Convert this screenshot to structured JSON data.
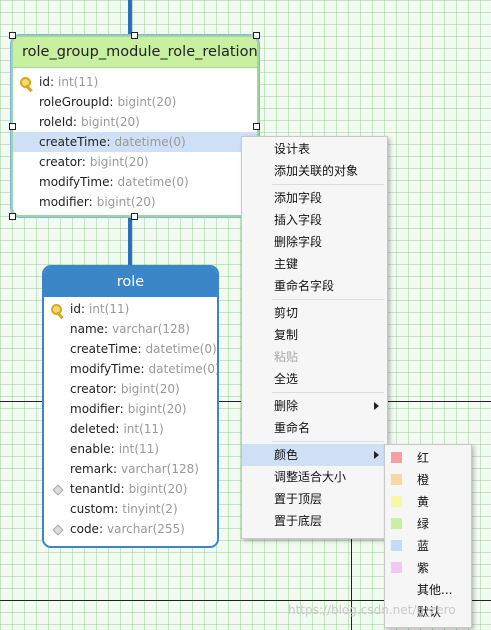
{
  "relation_entity": {
    "title": "role_group_module_role_relation",
    "fields": [
      {
        "name": "id:",
        "type": "int(11)",
        "key": true
      },
      {
        "name": "roleGroupId:",
        "type": "bigint(20)"
      },
      {
        "name": "roleId:",
        "type": "bigint(20)"
      },
      {
        "name": "createTime:",
        "type": "datetime(0)",
        "selected": true
      },
      {
        "name": "creator:",
        "type": "bigint(20)"
      },
      {
        "name": "modifyTime:",
        "type": "datetime(0)"
      },
      {
        "name": "modifier:",
        "type": "bigint(20)"
      }
    ]
  },
  "role_entity": {
    "title": "role",
    "fields": [
      {
        "name": "id:",
        "type": "int(11)",
        "icon": "key"
      },
      {
        "name": "name:",
        "type": "varchar(128)"
      },
      {
        "name": "createTime:",
        "type": "datetime(0)"
      },
      {
        "name": "modifyTime:",
        "type": "datetime(0)"
      },
      {
        "name": "creator:",
        "type": "bigint(20)"
      },
      {
        "name": "modifier:",
        "type": "bigint(20)"
      },
      {
        "name": "deleted:",
        "type": "int(11)"
      },
      {
        "name": "enable:",
        "type": "int(11)"
      },
      {
        "name": "remark:",
        "type": "varchar(128)"
      },
      {
        "name": "tenantId:",
        "type": "bigint(20)",
        "icon": "diamond"
      },
      {
        "name": "custom:",
        "type": "tinyint(2)"
      },
      {
        "name": "code:",
        "type": "varchar(255)",
        "icon": "diamond"
      }
    ]
  },
  "context_menu": {
    "items": [
      {
        "label": "设计表"
      },
      {
        "label": "添加关联的对象"
      },
      {
        "sep": true
      },
      {
        "label": "添加字段"
      },
      {
        "label": "插入字段"
      },
      {
        "label": "删除字段"
      },
      {
        "label": "主键"
      },
      {
        "label": "重命名字段"
      },
      {
        "sep": true
      },
      {
        "label": "剪切"
      },
      {
        "label": "复制"
      },
      {
        "label": "粘贴",
        "disabled": true
      },
      {
        "label": "全选"
      },
      {
        "sep": true
      },
      {
        "label": "删除",
        "submenu": true
      },
      {
        "label": "重命名"
      },
      {
        "sep": true
      },
      {
        "label": "颜色",
        "submenu": true,
        "active": true
      },
      {
        "label": "调整适合大小"
      },
      {
        "label": "置于顶层"
      },
      {
        "label": "置于底层"
      }
    ]
  },
  "color_submenu": {
    "items": [
      {
        "label": "红",
        "swatch": "#f4a0a0"
      },
      {
        "label": "橙",
        "swatch": "#f8d8a0"
      },
      {
        "label": "黄",
        "swatch": "#f8f8a0"
      },
      {
        "label": "绿",
        "swatch": "#c8f0a0"
      },
      {
        "label": "蓝",
        "swatch": "#c0dcf8"
      },
      {
        "label": "紫",
        "swatch": "#f0c8f0"
      },
      {
        "label": "其他..."
      },
      {
        "label": "默认"
      }
    ]
  },
  "watermark": "https://blog.csdn.net/u_zero",
  "colors": {
    "canvas": "#f2fbf2",
    "relation_header": "#c8f0a0",
    "role_header": "#3b86c8",
    "selection": "#cfe0f6",
    "connector": "#2a6fc0"
  }
}
